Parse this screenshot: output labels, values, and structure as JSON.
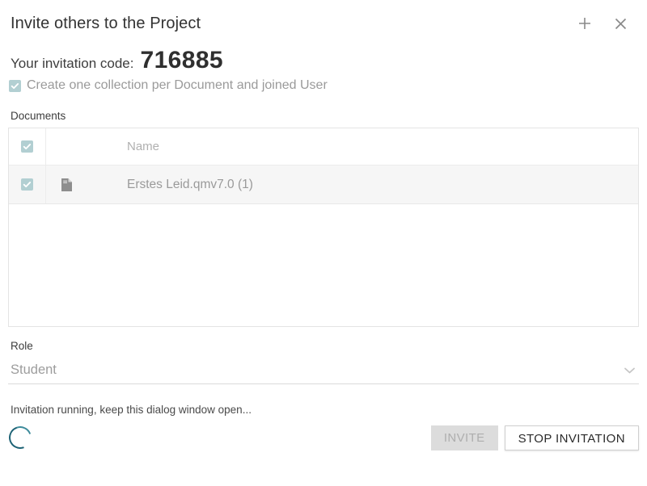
{
  "header": {
    "title": "Invite others to the Project",
    "add_icon": "plus-icon",
    "close_icon": "close-icon"
  },
  "invitation": {
    "code_label": "Your invitation code:",
    "code_value": "716885",
    "option_label": "Create one collection per Document and joined User",
    "option_checked": true
  },
  "documents": {
    "section_label": "Documents",
    "columns": {
      "select_all_checked": true,
      "name_header": "Name"
    },
    "rows": [
      {
        "checked": true,
        "icon": "document-icon",
        "name": "Erstes Leid.qmv7.0 (1)"
      }
    ]
  },
  "role": {
    "label": "Role",
    "value": "Student",
    "chevron_icon": "chevron-down-icon"
  },
  "footer": {
    "status": "Invitation running, keep this dialog window open...",
    "spinner_icon": "loading-spinner-icon",
    "invite_label": "INVITE",
    "invite_disabled": true,
    "stop_label": "STOP INVITATION"
  },
  "colors": {
    "checkbox_teal": "#b2cfd2",
    "spinner_teal": "#1d6275",
    "text_primary": "#3c3c3c",
    "text_muted": "#9a9a9a",
    "disabled_btn_bg": "#dcdcdc"
  }
}
